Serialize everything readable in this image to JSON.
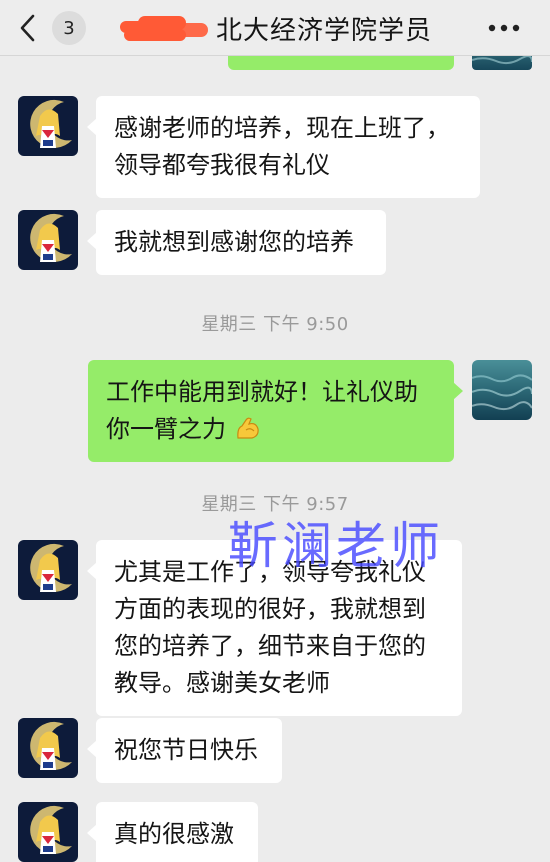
{
  "header": {
    "unread_count": "3",
    "title": "北大经济学院学员",
    "icons": {
      "back": "chevron-left-icon",
      "more": "more-dots-icon"
    }
  },
  "messages": [
    {
      "side": "left",
      "text_lines": [
        "感谢老师的培养，现在上班了，",
        "领导都夸我很有礼仪"
      ]
    },
    {
      "side": "left",
      "text_lines": [
        "我就想到感谢您的培养"
      ]
    },
    {
      "type": "timestamp",
      "text": "星期三 下午 9:50"
    },
    {
      "side": "right",
      "text_lines": [
        "工作中能用到就好！让礼仪助",
        "你一臂之力"
      ],
      "emoji": "flexed-biceps-icon"
    },
    {
      "type": "timestamp",
      "text": "星期三 下午 9:57"
    },
    {
      "side": "left",
      "text_lines": [
        "尤其是工作了，领导夸我礼仪",
        "方面的表现的很好，我就想到",
        "您的培养了，细节来自于您的",
        "教导。感谢美女老师"
      ]
    },
    {
      "side": "left",
      "text_lines": [
        "祝您节日快乐"
      ]
    },
    {
      "side": "left",
      "text_lines": [
        "真的很感激"
      ]
    }
  ],
  "watermark": "靳澜老师",
  "colors": {
    "background": "#ececec",
    "header": "#ededed",
    "bubble_self": "#95ec69",
    "bubble_other": "#ffffff",
    "timestamp": "#9a9a9a",
    "watermark": "#484aff",
    "redaction": "#ff5a36"
  }
}
